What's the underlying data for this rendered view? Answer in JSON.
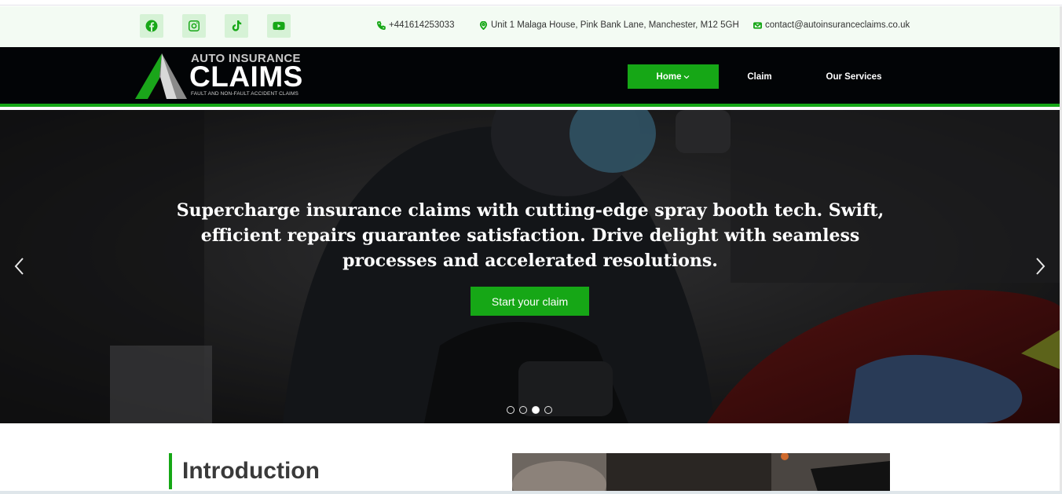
{
  "social": [
    {
      "name": "facebook-icon"
    },
    {
      "name": "instagram-icon"
    },
    {
      "name": "tiktok-icon"
    },
    {
      "name": "youtube-icon"
    }
  ],
  "contact": {
    "phone": "+441614253033",
    "address": "Unit 1 Malaga House, Pink Bank Lane, Manchester, M12 5GH",
    "email": "contact@autoinsuranceclaims.co.uk"
  },
  "logo": {
    "top": "AUTO INSURANCE",
    "main": "CLAIMS",
    "sub": "FAULT AND NON-FAULT ACCIDENT CLAIMS"
  },
  "nav": {
    "home": "Home",
    "claim": "Claim",
    "services": "Our Services"
  },
  "hero": {
    "headline": "Supercharge insurance claims with cutting-edge spray booth tech. Swift, efficient repairs guarantee satisfaction. Drive delight with seamless processes and accelerated resolutions.",
    "cta": "Start your claim",
    "slide_count": 4,
    "active_slide": 3
  },
  "intro": {
    "heading": "Introduction"
  },
  "colors": {
    "accent": "#16a716",
    "nav_bg": "#020406",
    "infobar_bg": "#f3fbf3"
  }
}
